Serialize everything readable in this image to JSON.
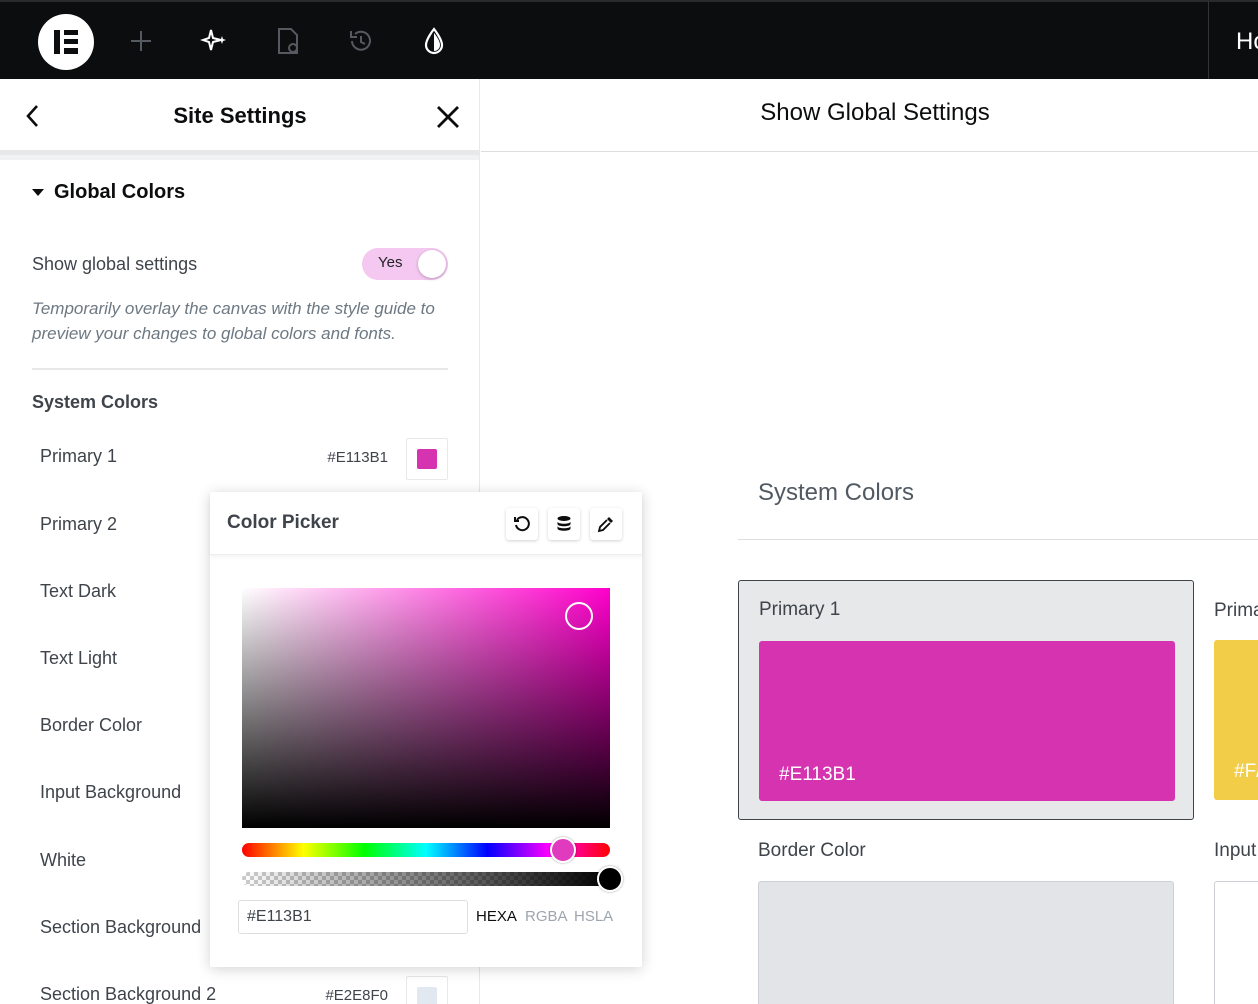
{
  "topbar": {
    "title": "Ho"
  },
  "panel": {
    "title": "Site Settings",
    "section_title": "Global Colors",
    "show_global_label": "Show global settings",
    "toggle_label": "Yes",
    "help_text": "Temporarily overlay the canvas with the style guide to preview your changes to global colors and fonts.",
    "system_colors_title": "System Colors",
    "colors": [
      {
        "name": "Primary 1",
        "hex": "#E113B1",
        "swatch": "#d633b1"
      },
      {
        "name": "Primary 2"
      },
      {
        "name": "Text Dark"
      },
      {
        "name": "Text Light"
      },
      {
        "name": "Border Color"
      },
      {
        "name": "Input Background"
      },
      {
        "name": "White"
      },
      {
        "name": "Section Background"
      },
      {
        "name": "Section Background 2",
        "hex": "#E2E8F0",
        "swatch": "#e2e8f0"
      }
    ]
  },
  "picker": {
    "title": "Color Picker",
    "hex_value": "#E113B1",
    "formats": [
      "HEXA",
      "RGBA",
      "HSLA"
    ],
    "active_format": "HEXA",
    "hue_color": "#ff00cc"
  },
  "canvas": {
    "title": "Show Global Settings",
    "system_colors_title": "System Colors",
    "card1": {
      "name": "Primary 1",
      "hex": "#E113B1",
      "color": "#d633b1"
    },
    "card2": {
      "name": "Prima",
      "hex": "#F/",
      "color": "#f2cd48"
    },
    "border_color_label": "Border Color",
    "border_color_swatch": "#e2e4e7",
    "input_label": "Input",
    "input_swatch": "#ffffff"
  },
  "colors": {
    "topbar_bg": "#0c0d0e",
    "toggle_on": "#f4c8f0"
  }
}
